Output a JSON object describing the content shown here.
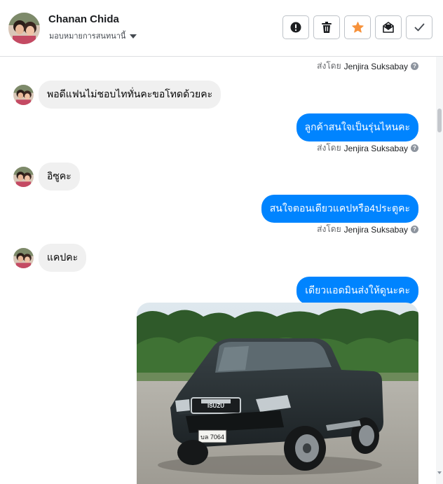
{
  "header": {
    "name": "Chanan Chida",
    "assign_label": "มอบหมายการสนทนานี้"
  },
  "toolbar": {
    "buttons": [
      "alert-icon",
      "trash-icon",
      "star-icon",
      "mark-unread-icon",
      "check-icon"
    ],
    "star_color": "#f7923b"
  },
  "thread": {
    "sent_by_prefix": "ส่งโดย",
    "sender": "Jenjira Suksabay",
    "messages": [
      {
        "dir": "in",
        "text": "พอดีแฟนไม่ชอบไททั่นคะขอโทดด้วยคะ"
      },
      {
        "dir": "out",
        "text": "ลูกค้าสนใจเป็นรุ่นไหนคะ"
      },
      {
        "dir": "in",
        "text": "อิซูคะ"
      },
      {
        "dir": "out",
        "text": "สนใจตอนเดียวแคปหรือ4ประตูคะ"
      },
      {
        "dir": "in",
        "text": "แคปคะ"
      },
      {
        "dir": "out",
        "text": "เดียวแอดมินส่งให้ดูนะคะ"
      }
    ],
    "photo": {
      "subject": "black pickup truck",
      "grille_badge": "ISUZU",
      "plate": "บล 7064"
    }
  },
  "colors": {
    "outgoing_bubble": "#0084ff",
    "incoming_bubble": "#f0f0f0"
  }
}
